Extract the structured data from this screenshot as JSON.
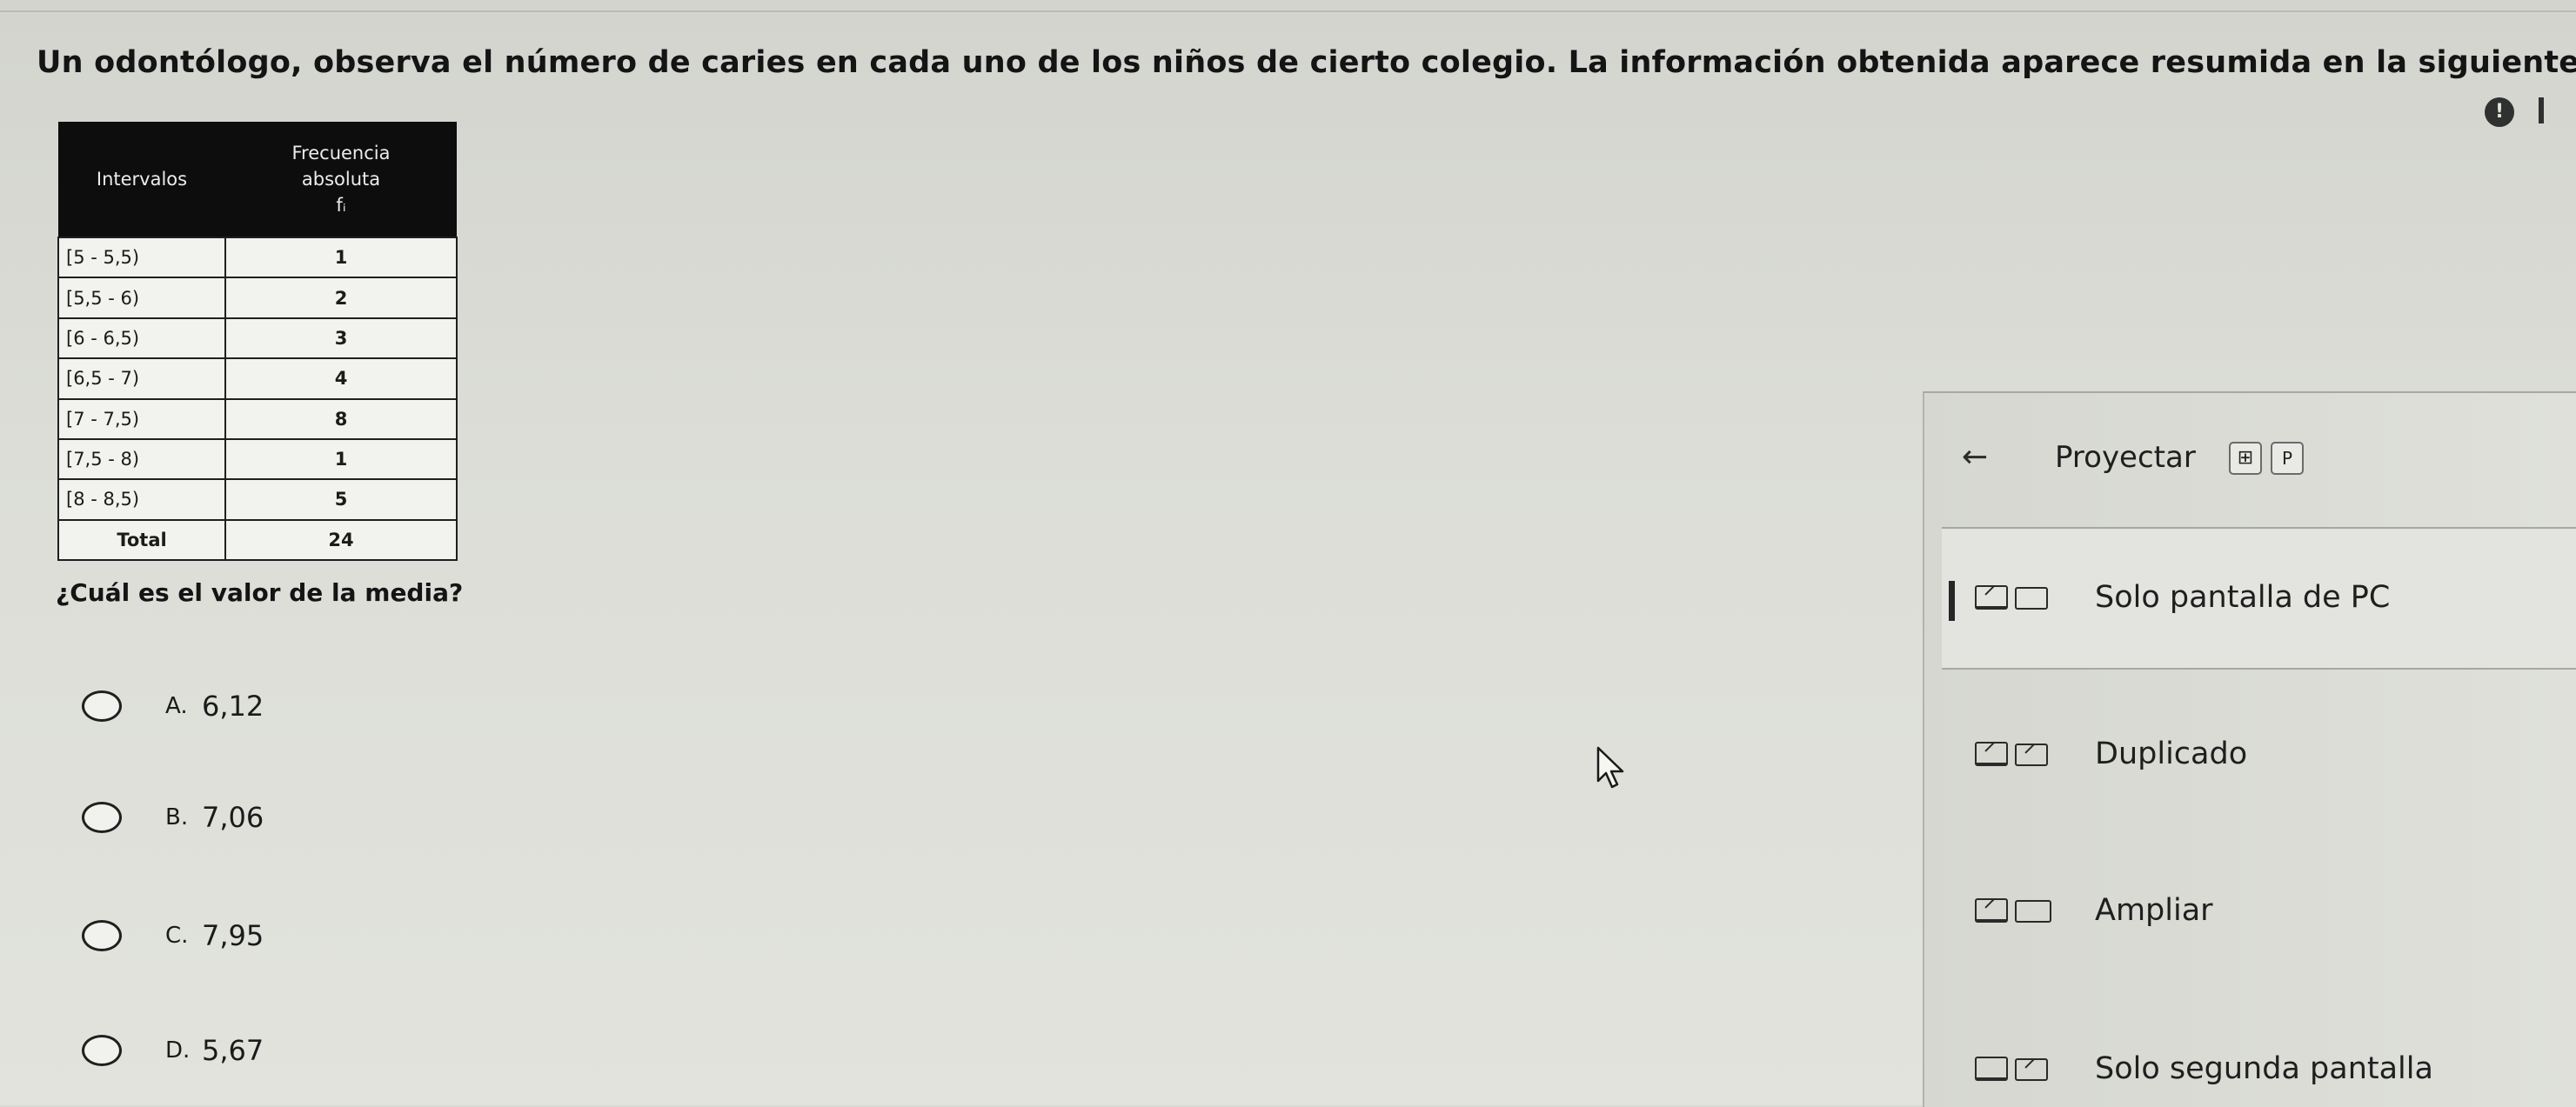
{
  "question": {
    "title": "Un odontólogo, observa el número de caries en cada uno de los niños de cierto colegio. La información obtenida aparece resumida en la siguiente tabla:",
    "prompt": "¿Cuál es el valor de la media?"
  },
  "table": {
    "headers": [
      "Intervalos",
      "Frecuencia absoluta",
      "fᵢ"
    ],
    "header_col2_line1": "Frecuencia",
    "header_col2_line2": "absoluta",
    "header_col2_line3": "fᵢ",
    "rows": [
      {
        "interval": "[5 - 5,5)",
        "freq": "1"
      },
      {
        "interval": "[5,5 - 6)",
        "freq": "2"
      },
      {
        "interval": "[6 - 6,5)",
        "freq": "3"
      },
      {
        "interval": "[6,5 - 7)",
        "freq": "4"
      },
      {
        "interval": "[7 - 7,5)",
        "freq": "8"
      },
      {
        "interval": "[7,5 - 8)",
        "freq": "1"
      },
      {
        "interval": "[8 - 8,5)",
        "freq": "5"
      }
    ],
    "total_label": "Total",
    "total_value": "24"
  },
  "options": [
    {
      "letter": "A.",
      "value": "6,12"
    },
    {
      "letter": "B.",
      "value": "7,06"
    },
    {
      "letter": "C.",
      "value": "7,95"
    },
    {
      "letter": "D.",
      "value": "5,67"
    }
  ],
  "project_panel": {
    "title": "Proyectar",
    "back_icon": "arrow-left-icon",
    "shortcut_keys": [
      "⊞",
      "P"
    ],
    "modes": [
      {
        "label": "Solo pantalla de PC",
        "icon": "pc-screen-only-icon",
        "selected": true
      },
      {
        "label": "Duplicado",
        "icon": "duplicate-icon",
        "selected": false
      },
      {
        "label": "Ampliar",
        "icon": "extend-icon",
        "selected": false
      },
      {
        "label": "Solo segunda pantalla",
        "icon": "second-screen-only-icon",
        "selected": false
      }
    ]
  },
  "colors": {
    "background": "#d9dad4",
    "table_header": "#0d0d0d",
    "panel": "#dcddd7"
  }
}
